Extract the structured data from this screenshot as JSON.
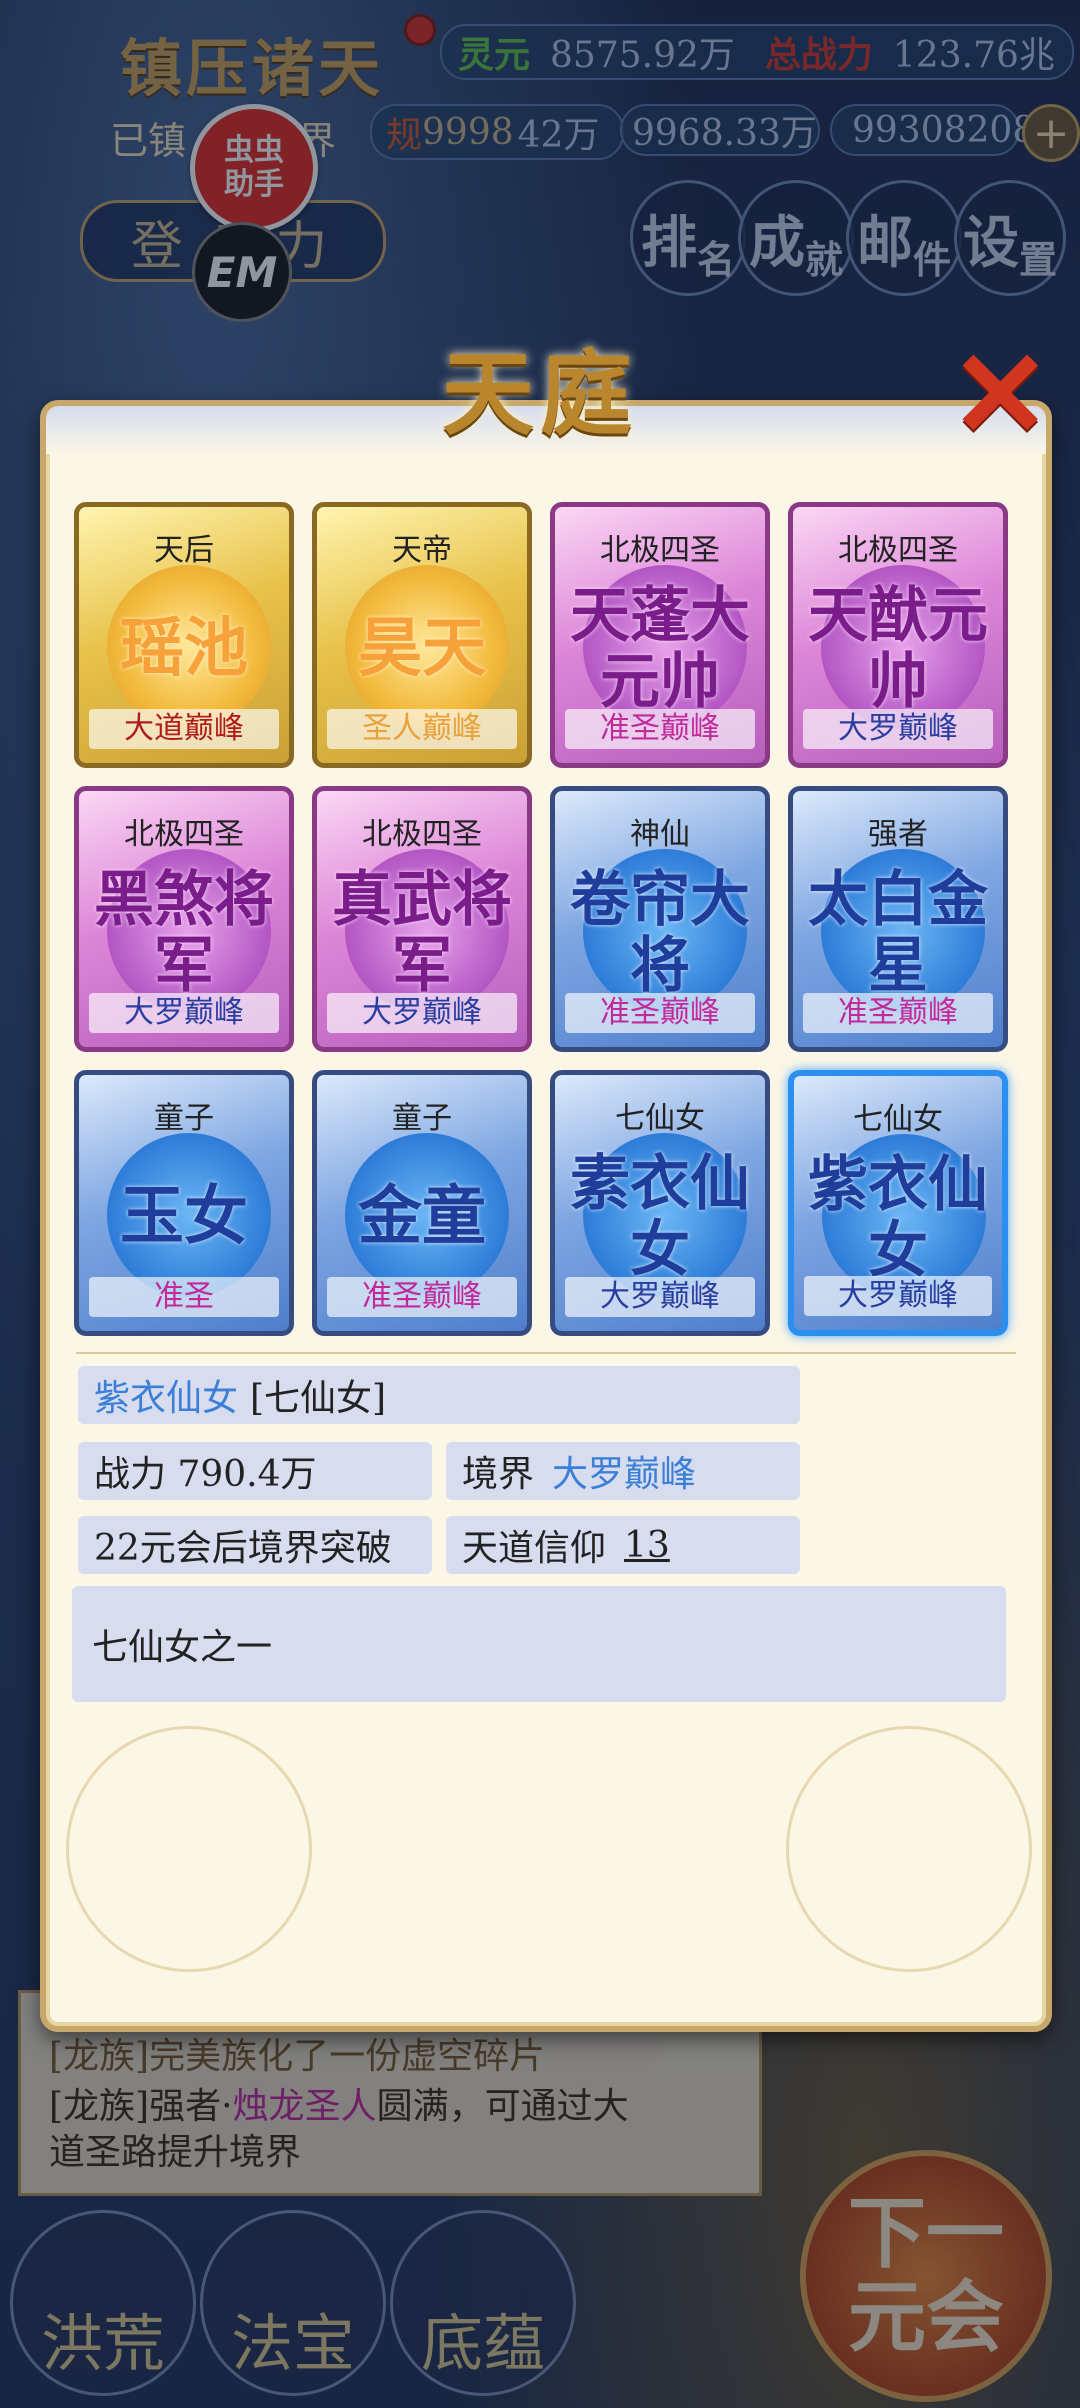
{
  "header": {
    "game_title": "镇压诸天",
    "lingyuan_label": "灵元",
    "lingyuan_value": "8575.92万",
    "power_label": "总战力",
    "power_value": "123.76兆",
    "sub_title": "已镇",
    "sub_title_tail": "界",
    "guize_label": "规",
    "guize_value": "9998",
    "stat2_value": "42万",
    "stat3_value": "9968.33万",
    "stat4_value": "99308208",
    "login_label": "登  势力",
    "overlay_app": "虫虫助手",
    "overlay_app_line1": "虫虫",
    "overlay_app_line2": "助手",
    "overlay_em": "EM",
    "top_buttons": [
      {
        "big": "排",
        "small": "名"
      },
      {
        "big": "成",
        "small": "就"
      },
      {
        "big": "邮",
        "small": "件"
      },
      {
        "big": "设",
        "small": "置"
      }
    ]
  },
  "modal": {
    "title": "天庭",
    "close_symbol": "✕",
    "cards": [
      {
        "top": "天后",
        "name": "瑶池",
        "rank": "大道巅峰",
        "style": "gold",
        "rank_color": "#b01c1c"
      },
      {
        "top": "天帝",
        "name": "昊天",
        "rank": "圣人巅峰",
        "style": "gold",
        "rank_color": "#e8a23a"
      },
      {
        "top": "北极四圣",
        "name": "天蓬大元帅",
        "rank": "准圣巅峰",
        "style": "purple",
        "rank_color": "#c02a9a"
      },
      {
        "top": "北极四圣",
        "name": "天猷元帅",
        "rank": "大罗巅峰",
        "style": "purple",
        "rank_color": "#2a3ea0"
      },
      {
        "top": "北极四圣",
        "name": "黑煞将军",
        "rank": "大罗巅峰",
        "style": "purple",
        "rank_color": "#2a3ea0"
      },
      {
        "top": "北极四圣",
        "name": "真武将军",
        "rank": "大罗巅峰",
        "style": "purple",
        "rank_color": "#2a3ea0"
      },
      {
        "top": "神仙",
        "name": "卷帘大将",
        "rank": "准圣巅峰",
        "style": "blue",
        "rank_color": "#c02a9a"
      },
      {
        "top": "强者",
        "name": "太白金星",
        "rank": "准圣巅峰",
        "style": "blue",
        "rank_color": "#c02a9a"
      },
      {
        "top": "童子",
        "name": "玉女",
        "rank": "准圣",
        "style": "blue",
        "rank_color": "#c02a9a"
      },
      {
        "top": "童子",
        "name": "金童",
        "rank": "准圣巅峰",
        "style": "blue",
        "rank_color": "#c02a9a"
      },
      {
        "top": "七仙女",
        "name": "素衣仙女",
        "rank": "大罗巅峰",
        "style": "blue",
        "rank_color": "#2a3ea0"
      },
      {
        "top": "七仙女",
        "name": "紫衣仙女",
        "rank": "大罗巅峰",
        "style": "blue",
        "rank_color": "#2a3ea0",
        "selected": true
      }
    ],
    "detail": {
      "name": "紫衣仙女",
      "group": "[七仙女]",
      "power": "战力 790.4万",
      "realm_label": "境界",
      "realm_value": "大罗巅峰",
      "breakthrough": "22元会后境界突破",
      "faith_label": "天道信仰",
      "faith_value": "13",
      "description": "七仙女之一"
    }
  },
  "log": {
    "line1": "[龙族]完美族化了一份虚空碎片",
    "line2_prefix": "[龙族]强者·",
    "line2_name": "烛龙圣人",
    "line2_suffix": "圆满，可通过大",
    "line3": "道圣路提升境界"
  },
  "bottom_nav": [
    "洪荒",
    "法宝",
    "底蕴"
  ],
  "next_button": {
    "line1": "下一",
    "line2": "元会"
  }
}
